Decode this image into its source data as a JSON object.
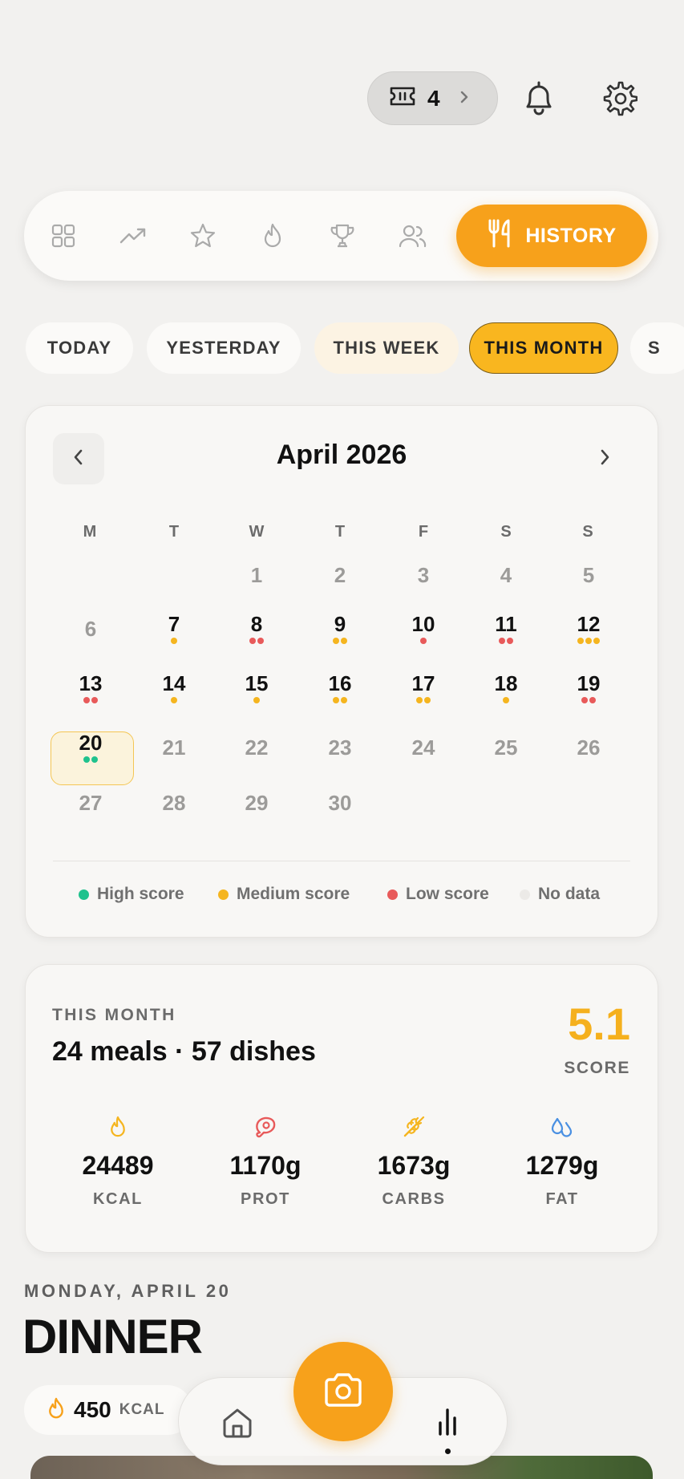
{
  "header": {
    "tickets": {
      "icon": "ticket-icon",
      "count": "4"
    },
    "icons": [
      "bell-icon",
      "gear-icon"
    ]
  },
  "nav": {
    "icons": [
      "grid-icon",
      "trending-icon",
      "star-icon",
      "flame-icon",
      "trophy-icon",
      "users-icon"
    ],
    "active": {
      "icon": "utensils-icon",
      "label": "HISTORY"
    }
  },
  "filters": {
    "chips": [
      "TODAY",
      "YESTERDAY",
      "THIS WEEK",
      "THIS MONTH",
      "S"
    ],
    "selected": "THIS MONTH"
  },
  "calendar": {
    "month_title": "April 2026",
    "weekdays": [
      "M",
      "T",
      "W",
      "T",
      "F",
      "S",
      "S"
    ],
    "colors": {
      "high": "#1fc28d",
      "medium": "#f5b51f",
      "low": "#e85a5a",
      "none": "#e6e4e1"
    },
    "days": [
      {
        "d": "1",
        "dots": []
      },
      {
        "d": "2",
        "dots": []
      },
      {
        "d": "3",
        "dots": []
      },
      {
        "d": "4",
        "dots": []
      },
      {
        "d": "5",
        "dots": []
      },
      {
        "d": "6",
        "dots": []
      },
      {
        "d": "7",
        "dots": [
          "medium"
        ]
      },
      {
        "d": "8",
        "dots": [
          "low",
          "low"
        ]
      },
      {
        "d": "9",
        "dots": [
          "medium",
          "medium"
        ]
      },
      {
        "d": "10",
        "dots": [
          "low"
        ]
      },
      {
        "d": "11",
        "dots": [
          "low",
          "low"
        ]
      },
      {
        "d": "12",
        "dots": [
          "medium",
          "medium",
          "medium"
        ]
      },
      {
        "d": "13",
        "dots": [
          "low",
          "low"
        ]
      },
      {
        "d": "14",
        "dots": [
          "medium"
        ]
      },
      {
        "d": "15",
        "dots": [
          "medium"
        ]
      },
      {
        "d": "16",
        "dots": [
          "medium",
          "medium"
        ]
      },
      {
        "d": "17",
        "dots": [
          "medium",
          "medium"
        ]
      },
      {
        "d": "18",
        "dots": [
          "medium"
        ]
      },
      {
        "d": "19",
        "dots": [
          "low",
          "low"
        ]
      },
      {
        "d": "20",
        "dots": [
          "high",
          "high"
        ],
        "today": true
      },
      {
        "d": "21",
        "dots": []
      },
      {
        "d": "22",
        "dots": []
      },
      {
        "d": "23",
        "dots": []
      },
      {
        "d": "24",
        "dots": []
      },
      {
        "d": "25",
        "dots": []
      },
      {
        "d": "26",
        "dots": []
      },
      {
        "d": "27",
        "dots": []
      },
      {
        "d": "28",
        "dots": []
      },
      {
        "d": "29",
        "dots": []
      },
      {
        "d": "30",
        "dots": []
      }
    ],
    "legend": [
      {
        "label": "High score",
        "color": "#1fc28d"
      },
      {
        "label": "Medium score",
        "color": "#f5b51f"
      },
      {
        "label": "Low score",
        "color": "#e85a5a"
      },
      {
        "label": "No data",
        "color": "#eceae7"
      }
    ]
  },
  "summary": {
    "period_label": "THIS MONTH",
    "title": "24 meals · 57 dishes",
    "score_value": "5.1",
    "score_label": "SCORE",
    "macros": [
      {
        "value": "24489",
        "label": "KCAL",
        "icon": "flame-icon",
        "color": "#f5b51f"
      },
      {
        "value": "1170g",
        "label": "PROT",
        "icon": "meat-icon",
        "color": "#e85a5a"
      },
      {
        "value": "1673g",
        "label": "CARBS",
        "icon": "wheat-icon",
        "color": "#f5b51f"
      },
      {
        "value": "1279g",
        "label": "FAT",
        "icon": "droplets-icon",
        "color": "#4a90e2"
      }
    ]
  },
  "meal": {
    "date_label": "MONDAY, APRIL 20",
    "title": "DINNER",
    "kcal_value": "450",
    "kcal_label": "KCAL"
  },
  "bottom_nav": {
    "icons": [
      "home-icon",
      "camera-icon",
      "stats-icon"
    ],
    "accent": "#f7a11b"
  }
}
